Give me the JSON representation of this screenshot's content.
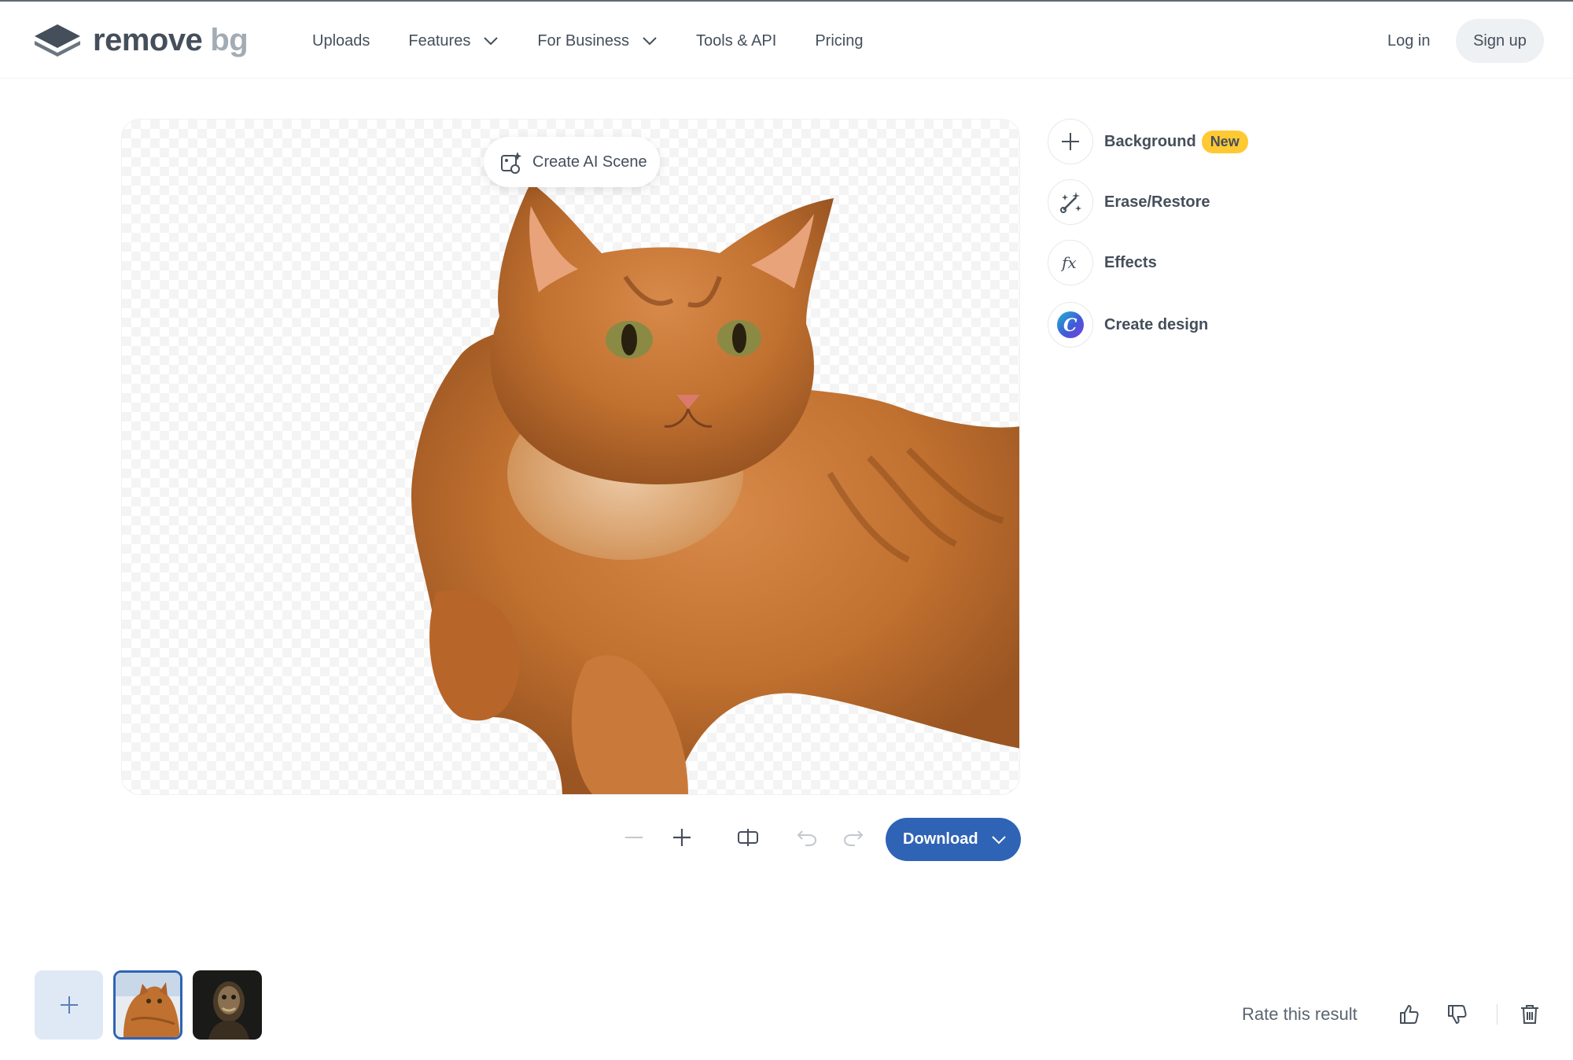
{
  "brand": {
    "name_main": "remove",
    "name_suffix": "bg"
  },
  "nav": {
    "items": [
      {
        "label": "Uploads",
        "dropdown": false
      },
      {
        "label": "Features",
        "dropdown": true
      },
      {
        "label": "For Business",
        "dropdown": true
      },
      {
        "label": "Tools & API",
        "dropdown": false
      },
      {
        "label": "Pricing",
        "dropdown": false
      }
    ],
    "login": "Log in",
    "signup": "Sign up"
  },
  "editor": {
    "ai_scene_label": "Create AI Scene",
    "tools": [
      {
        "label": "Background",
        "icon": "plus-icon",
        "badge": "New"
      },
      {
        "label": "Erase/Restore",
        "icon": "magic-brush-icon"
      },
      {
        "label": "Effects",
        "icon": "fx-icon"
      },
      {
        "label": "Create design",
        "icon": "canva-icon"
      }
    ],
    "download_label": "Download"
  },
  "footer": {
    "rate_label": "Rate this result"
  },
  "colors": {
    "accent": "#2f63b5",
    "badge": "#ffc933",
    "text": "#454f5b",
    "upload_tile": "#dfe9f6"
  }
}
